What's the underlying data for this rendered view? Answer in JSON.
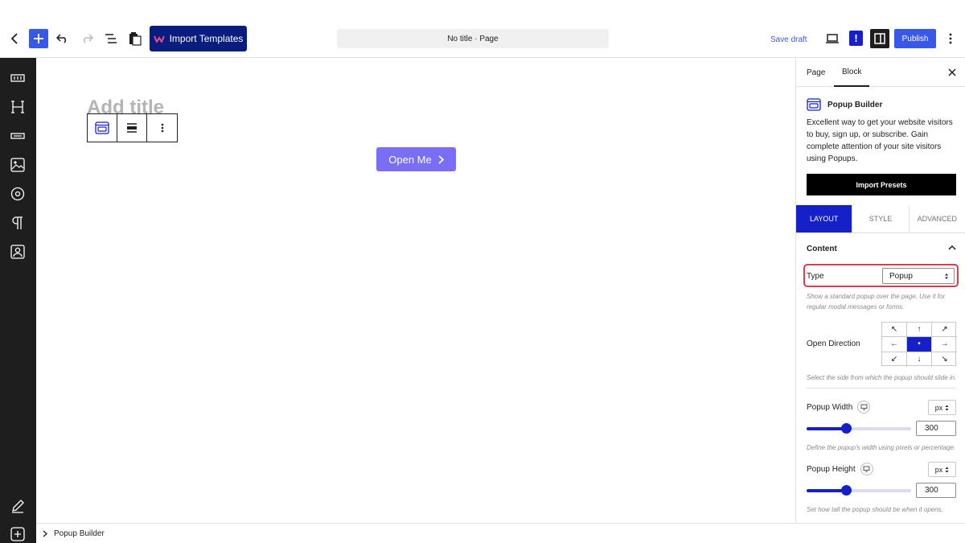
{
  "toolbar": {
    "import_label": "Import Templates",
    "doc_title": "No title · Page",
    "save_draft": "Save draft",
    "notice_mark": "!",
    "publish": "Publish"
  },
  "canvas": {
    "title_placeholder": "Add title",
    "button_label": "Open Me"
  },
  "footer": {
    "breadcrumb": "Popup Builder"
  },
  "panel": {
    "tabs": [
      "Page",
      "Block"
    ],
    "block_name": "Popup Builder",
    "block_description": "Excellent way to get your website visitors to buy, sign up, or subscribe. Gain complete attention of your site visitors using Popups.",
    "import_presets": "Import Presets",
    "section_tabs": [
      "LAYOUT",
      "STYLE",
      "ADVANCED"
    ],
    "content_heading": "Content",
    "type_label": "Type",
    "type_value": "Popup",
    "type_help": "Show a standard popup over the page. Use it for regular modal messages or forms.",
    "open_direction_label": "Open Direction",
    "directions": [
      "↖",
      "↑",
      "↗",
      "←",
      "•",
      "→",
      "↙",
      "↓",
      "↘"
    ],
    "open_direction_help": "Select the side from which the popup should slide in.",
    "width_label": "Popup Width",
    "width_unit": "px",
    "width_value": "300",
    "width_fraction": 0.38,
    "width_help": "Define the popup's width using pixels or percentage.",
    "height_label": "Popup Height",
    "height_unit": "px",
    "height_value": "300",
    "height_fraction": 0.38,
    "height_help": "Set how tall the popup should be when it opens."
  },
  "colors": {
    "accent": "#3858e9",
    "brand_dark": "#091d7e",
    "active_blue": "#1520c9",
    "button_purple": "#7b6ef6",
    "highlight_red": "#e03a4f"
  }
}
